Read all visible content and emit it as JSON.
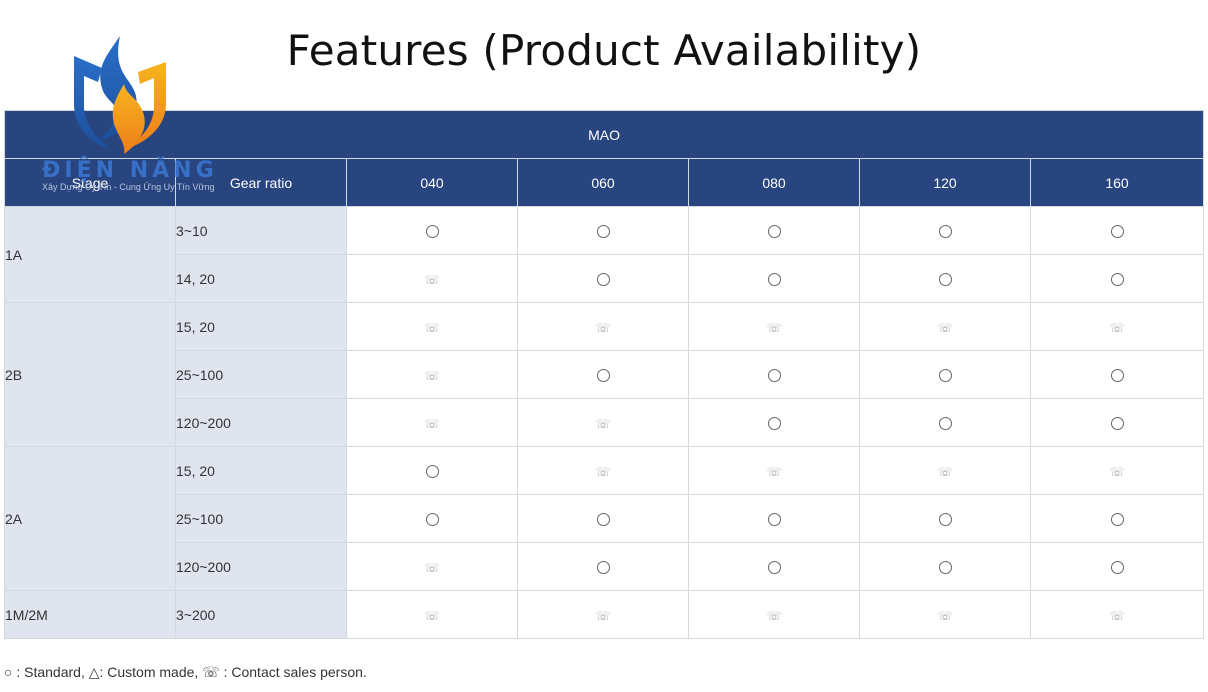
{
  "title": "Features (Product Availability)",
  "logo": {
    "text": "ĐIỆN NĂNG",
    "tagline": "Xây Dựng Uy Tín - Cung Ứng Uy Tín Vững"
  },
  "table": {
    "group_header": "MAO",
    "stage_header": "Stage",
    "ratio_header": "Gear ratio",
    "sizes": [
      "040",
      "060",
      "080",
      "120",
      "160"
    ],
    "groups": [
      {
        "stage": "1A",
        "rows": [
          {
            "ratio": "3~10",
            "cells": [
              "standard",
              "standard",
              "standard",
              "standard",
              "standard"
            ]
          },
          {
            "ratio": "14, 20",
            "cells": [
              "contact",
              "standard",
              "standard",
              "standard",
              "standard"
            ]
          }
        ]
      },
      {
        "stage": "2B",
        "rows": [
          {
            "ratio": "15, 20",
            "cells": [
              "contact",
              "contact",
              "contact",
              "contact",
              "contact"
            ]
          },
          {
            "ratio": "25~100",
            "cells": [
              "contact",
              "standard",
              "standard",
              "standard",
              "standard"
            ]
          },
          {
            "ratio": "120~200",
            "cells": [
              "contact",
              "contact",
              "standard",
              "standard",
              "standard"
            ]
          }
        ]
      },
      {
        "stage": "2A",
        "rows": [
          {
            "ratio": "15, 20",
            "cells": [
              "standard",
              "contact",
              "contact",
              "contact",
              "contact"
            ]
          },
          {
            "ratio": "25~100",
            "cells": [
              "standard",
              "standard",
              "standard",
              "standard",
              "standard"
            ]
          },
          {
            "ratio": "120~200",
            "cells": [
              "contact",
              "standard",
              "standard",
              "standard",
              "standard"
            ]
          }
        ]
      },
      {
        "stage": "1M/2M",
        "rows": [
          {
            "ratio": "3~200",
            "cells": [
              "contact",
              "contact",
              "contact",
              "contact",
              "contact"
            ]
          }
        ]
      }
    ]
  },
  "legend": "○ : Standard, △: Custom made, ☏ : Contact sales person.",
  "colors": {
    "header_bg": "#284580",
    "header_text": "#ffffff",
    "stage_bg": "#dfe4ef"
  },
  "icons": {
    "standard": "circle-icon",
    "contact": "phone-icon"
  }
}
